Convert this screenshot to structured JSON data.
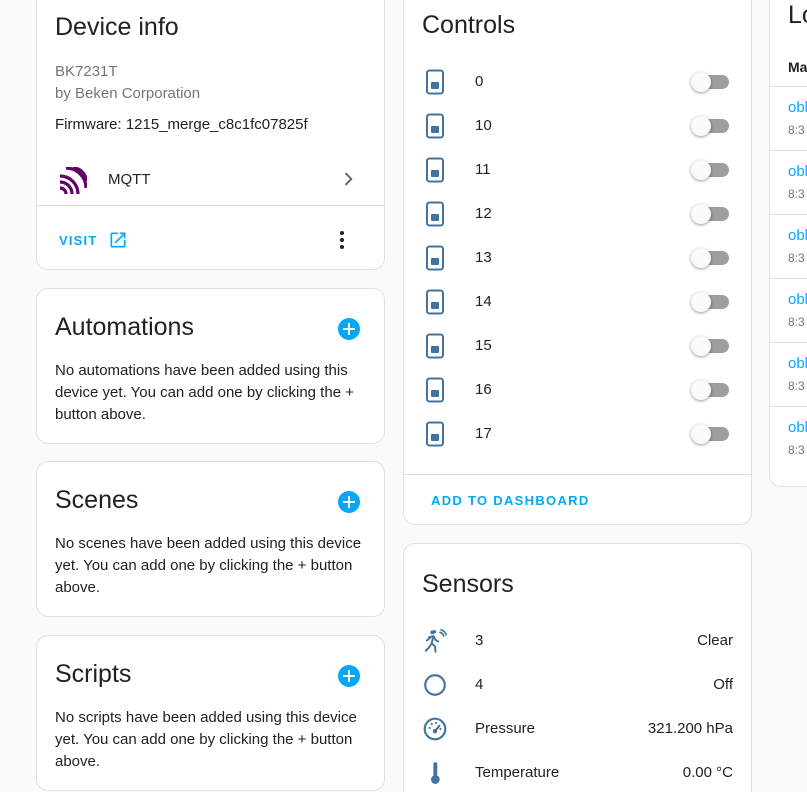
{
  "device_info": {
    "title": "Device info",
    "model": "BK7231T",
    "manufacturer": "by Beken Corporation",
    "firmware": "Firmware: 1215_merge_c8c1fc07825f",
    "integration": {
      "label": "MQTT",
      "icon": "mqtt-logo",
      "color": "#660066"
    },
    "visit_label": "VISIT"
  },
  "automations": {
    "title": "Automations",
    "empty_text": "No automations have been added using this device yet. You can add one by clicking the + button above."
  },
  "scenes": {
    "title": "Scenes",
    "empty_text": "No scenes have been added using this device yet. You can add one by clicking the + button above."
  },
  "scripts": {
    "title": "Scripts",
    "empty_text": "No scripts have been added using this device yet. You can add one by clicking the + button above."
  },
  "controls": {
    "title": "Controls",
    "items": [
      {
        "label": "0",
        "state": "off"
      },
      {
        "label": "10",
        "state": "off"
      },
      {
        "label": "11",
        "state": "off"
      },
      {
        "label": "12",
        "state": "off"
      },
      {
        "label": "13",
        "state": "off"
      },
      {
        "label": "14",
        "state": "off"
      },
      {
        "label": "15",
        "state": "off"
      },
      {
        "label": "16",
        "state": "off"
      },
      {
        "label": "17",
        "state": "off"
      }
    ],
    "add_to_dashboard": "ADD TO DASHBOARD"
  },
  "sensors": {
    "title": "Sensors",
    "items": [
      {
        "label": "3",
        "value": "Clear",
        "icon": "motion-sensor-icon"
      },
      {
        "label": "4",
        "value": "Off",
        "icon": "circle-outline-icon"
      },
      {
        "label": "Pressure",
        "value": "321.200 hPa",
        "icon": "gauge-icon"
      },
      {
        "label": "Temperature",
        "value": "0.00 °C",
        "icon": "thermometer-icon"
      }
    ]
  },
  "logbook": {
    "title_fragment": "Lo",
    "month_fragment": "Ma",
    "entries": [
      {
        "name": "obl",
        "time": "8:3"
      },
      {
        "name": "obl",
        "time": "8:3"
      },
      {
        "name": "obl",
        "time": "8:3"
      },
      {
        "name": "obl",
        "time": "8:3"
      },
      {
        "name": "obl",
        "time": "8:3"
      },
      {
        "name": "obl",
        "time": "8:3"
      }
    ]
  },
  "colors": {
    "accent": "#03a9f4",
    "icon": "#44739e",
    "toggle_off_track": "#9e9e9e"
  }
}
